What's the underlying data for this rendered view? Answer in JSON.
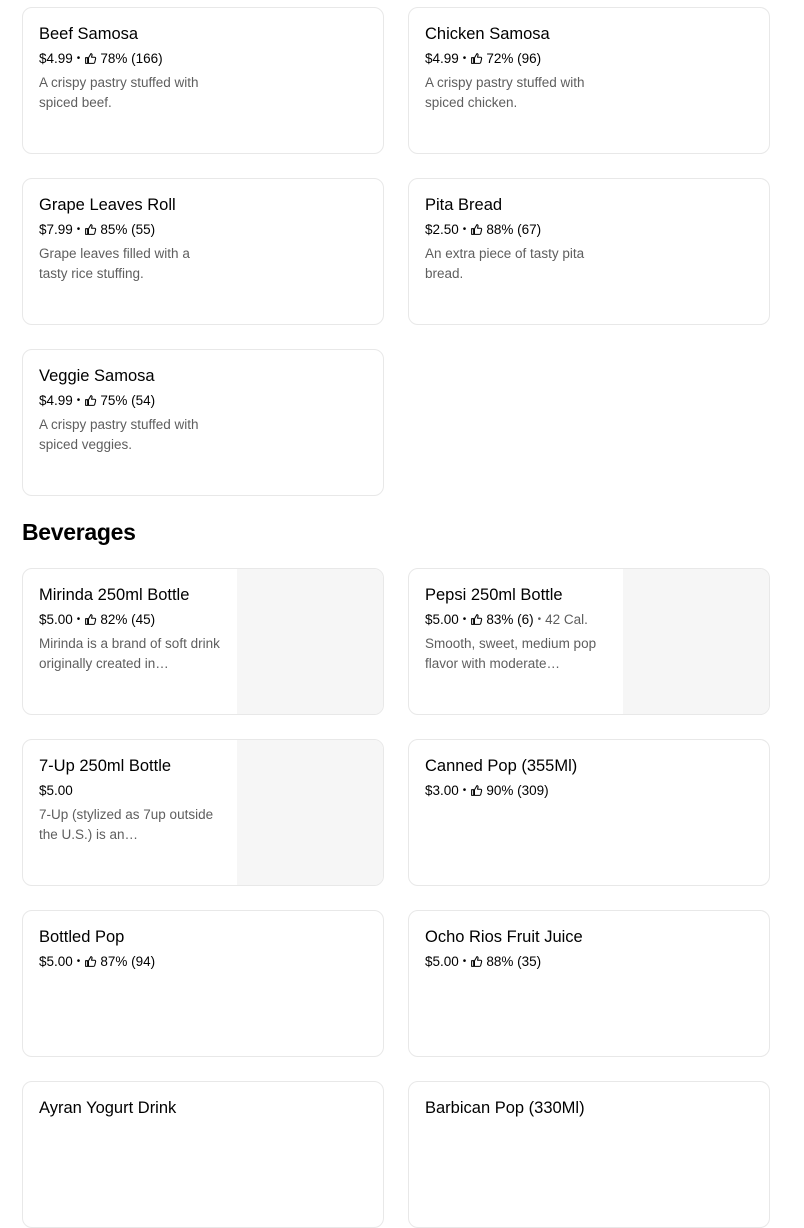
{
  "items": [
    {
      "name": "Beef Samosa",
      "price": "$4.99",
      "rating": "78% (166)",
      "desc": "A crispy pastry stuffed with spiced beef."
    },
    {
      "name": "Chicken Samosa",
      "price": "$4.99",
      "rating": "72% (96)",
      "desc": "A crispy pastry stuffed with spiced chicken."
    },
    {
      "name": "Grape Leaves Roll",
      "price": "$7.99",
      "rating": "85% (55)",
      "desc": "Grape leaves filled with a tasty rice stuffing."
    },
    {
      "name": "Pita Bread",
      "price": "$2.50",
      "rating": "88% (67)",
      "desc": "An extra piece of tasty pita bread."
    },
    {
      "name": "Veggie Samosa",
      "price": "$4.99",
      "rating": "75% (54)",
      "desc": "A crispy pastry stuffed with spiced veggies."
    }
  ],
  "beverages": {
    "title": "Beverages",
    "items": [
      {
        "name": "Mirinda 250ml Bottle",
        "price": "$5.00",
        "rating": "82% (45)",
        "desc": "Mirinda is a brand of soft drink originally created in…"
      },
      {
        "name": "Pepsi 250ml Bottle",
        "price": "$5.00",
        "rating": "83% (6)",
        "calories": "42 Cal.",
        "desc": "Smooth, sweet, medium pop flavor with moderate…"
      },
      {
        "name": "7-Up 250ml Bottle",
        "price": "$5.00",
        "desc": "7-Up (stylized as 7up outside the U.S.) is an…"
      },
      {
        "name": "Canned Pop (355Ml)",
        "price": "$3.00",
        "rating": "90% (309)"
      },
      {
        "name": "Bottled Pop",
        "price": "$5.00",
        "rating": "87% (94)"
      },
      {
        "name": "Ocho Rios Fruit Juice",
        "price": "$5.00",
        "rating": "88% (35)"
      },
      {
        "name": "Ayran Yogurt Drink"
      },
      {
        "name": "Barbican Pop (330Ml)"
      }
    ]
  }
}
